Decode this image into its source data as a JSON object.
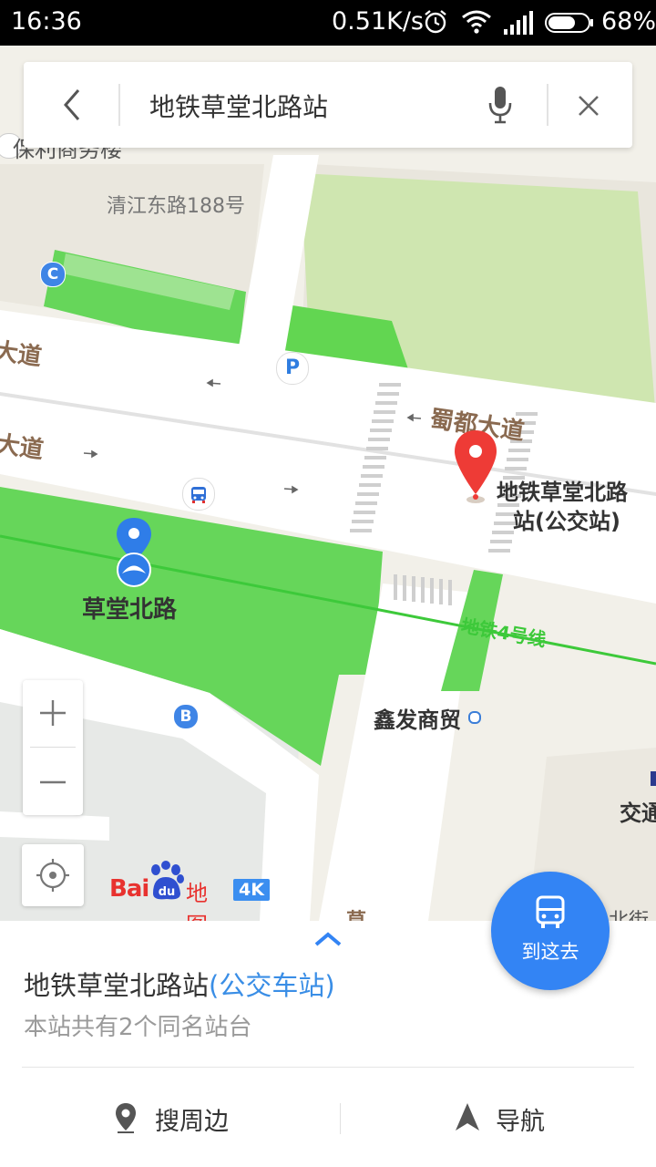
{
  "status_bar": {
    "time": "16:36",
    "network_speed": "0.51K/s",
    "battery_percent": "68%"
  },
  "search": {
    "query": "地铁草堂北路站"
  },
  "map": {
    "labels": {
      "building_top": "保利商务楼",
      "address": "清江东路188号",
      "road_left_1": "大道",
      "road_left_2": "大道",
      "road_right": "蜀都大道",
      "selected_station": "地铁草堂北路站(公交站)",
      "selected_station_line1": "地铁草堂北路",
      "selected_station_line2": "站(公交站)",
      "subway_station": "草堂北路",
      "subway_line": "地铁4号线",
      "poi_xinfa": "鑫发商贸",
      "poi_jiaotong": "交通",
      "road_bottom": "草",
      "poi_bottom_right": "北街"
    },
    "exit_badges": [
      "C",
      "B"
    ],
    "parking_badge": "P",
    "logo": {
      "bai": "Bai",
      "du": "du",
      "ditu": "地图",
      "resolution": "4K"
    }
  },
  "colors": {
    "accent_blue": "#3384f4",
    "pin_red": "#ee3b36",
    "green_area": "#66d65a",
    "road": "#ffffff"
  },
  "panel": {
    "title": "地铁草堂北路站",
    "category": "(公交车站)",
    "subtitle": "本站共有2个同名站台",
    "search_nearby": "搜周边",
    "navigate": "导航",
    "go_here": "到这去"
  }
}
